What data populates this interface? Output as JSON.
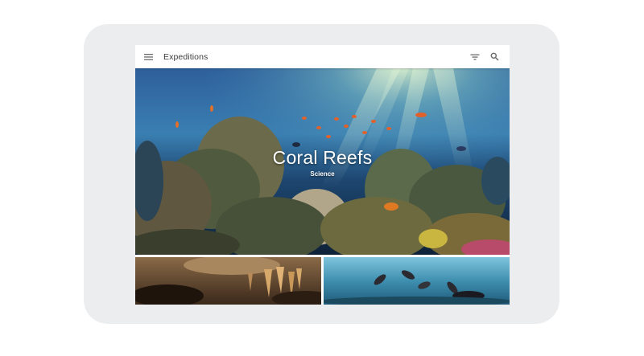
{
  "app": {
    "title": "Expeditions"
  },
  "toolbar": {
    "menu_icon": "hamburger-menu-icon",
    "filter_icon": "filter-icon",
    "search_icon": "search-icon"
  },
  "featured": {
    "title": "Coral Reefs",
    "category": "Science"
  },
  "thumbnails": [
    {
      "scene": "cave-stalactites"
    },
    {
      "scene": "underwater-sea-lions"
    }
  ],
  "colors": {
    "device_frame": "#ecedef",
    "appbar": "#ffffff",
    "title_text": "#3c3c3c",
    "icon": "#6b6b6b",
    "ocean_top": "#3f86b8",
    "ocean_bottom": "#0f2a4a"
  }
}
